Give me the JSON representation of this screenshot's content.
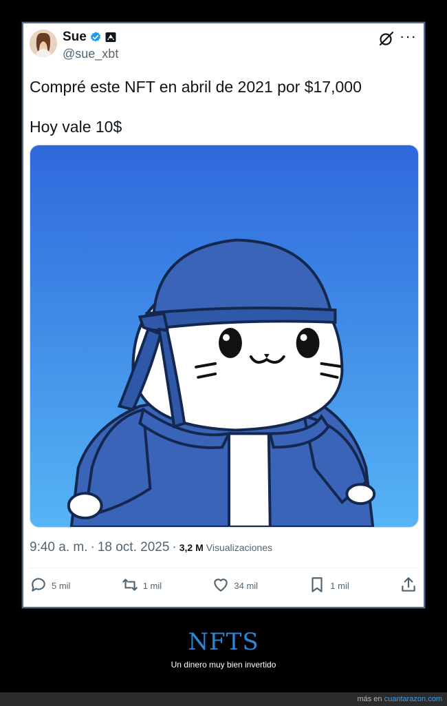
{
  "tweet": {
    "author": {
      "name": "Sue",
      "handle": "@sue_xbt"
    },
    "text_line1": "Compré este NFT en abril de 2021 por $17,000",
    "text_line2": "Hoy vale 10$",
    "time": "9:40 a. m.",
    "separator": "·",
    "date": "18 oct. 2025",
    "separator2": "·",
    "views_count": "3,2 M",
    "views_label": "Visualizaciones",
    "stats": {
      "replies": "5 mil",
      "reposts": "1 mil",
      "likes": "34 mil",
      "bookmarks": "1 mil"
    }
  },
  "footer": {
    "title": "NFTS",
    "subtitle": "Un dinero muy bien invertido",
    "credit_prefix": "más en",
    "credit_link": "cuantarazon.com"
  },
  "colors": {
    "verified": "#1d9bf0",
    "footer_title": "#2a86d6",
    "image_top": "#2f68db",
    "image_bottom": "#56b4f5"
  },
  "icons": [
    "verified-icon",
    "org-badge-icon",
    "grok-icon",
    "more-icon",
    "reply-icon",
    "repost-icon",
    "like-icon",
    "bookmark-icon",
    "share-icon"
  ]
}
